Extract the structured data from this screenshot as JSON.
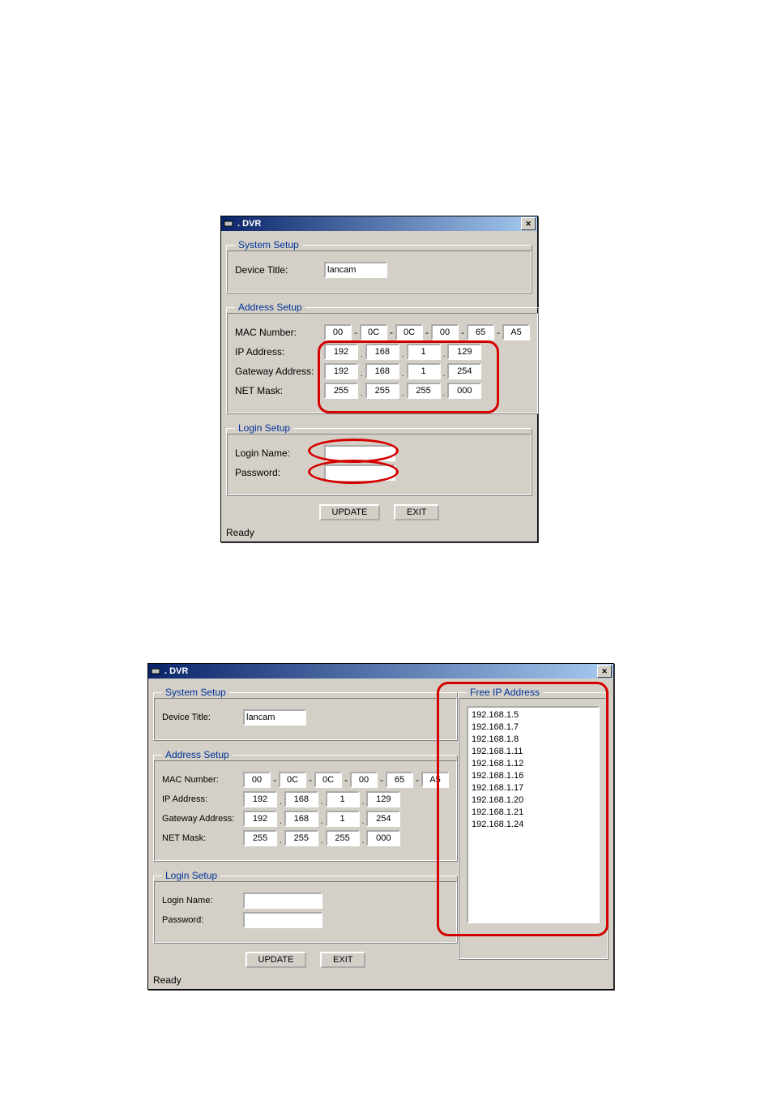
{
  "win1": {
    "title": ". DVR",
    "system_setup": {
      "legend": "System Setup",
      "device_title_label": "Device Title:",
      "device_title_value": "lancam"
    },
    "address_setup": {
      "legend": "Address Setup",
      "mac_label": "MAC Number:",
      "mac": [
        "00",
        "0C",
        "0C",
        "00",
        "65",
        "A5"
      ],
      "ip_label": "IP Address:",
      "ip": [
        "192",
        "168",
        "1",
        "129"
      ],
      "gw_label": "Gateway Address:",
      "gw": [
        "192",
        "168",
        "1",
        "254"
      ],
      "mask_label": "NET Mask:",
      "mask": [
        "255",
        "255",
        "255",
        "000"
      ]
    },
    "login_setup": {
      "legend": "Login Setup",
      "login_label": "Login Name:",
      "login_value": "",
      "password_label": "Password:",
      "password_value": ""
    },
    "buttons": {
      "update": "UPDATE",
      "exit": "EXIT"
    },
    "status": "Ready"
  },
  "win2": {
    "title": ". DVR",
    "system_setup": {
      "legend": "System Setup",
      "device_title_label": "Device Title:",
      "device_title_value": "lancam"
    },
    "address_setup": {
      "legend": "Address Setup",
      "mac_label": "MAC Number:",
      "mac": [
        "00",
        "0C",
        "0C",
        "00",
        "65",
        "A5"
      ],
      "ip_label": "IP Address:",
      "ip": [
        "192",
        "168",
        "1",
        "129"
      ],
      "gw_label": "Gateway Address:",
      "gw": [
        "192",
        "168",
        "1",
        "254"
      ],
      "mask_label": "NET Mask:",
      "mask": [
        "255",
        "255",
        "255",
        "000"
      ]
    },
    "login_setup": {
      "legend": "Login Setup",
      "login_label": "Login Name:",
      "login_value": "",
      "password_label": "Password:",
      "password_value": ""
    },
    "free_ip": {
      "legend": "Free IP Address",
      "items": [
        "192.168.1.5",
        "192.168.1.7",
        "192.168.1.8",
        "192.168.1.11",
        "192.168.1.12",
        "192.168.1.16",
        "192.168.1.17",
        "192.168.1.20",
        "192.168.1.21",
        "192.168.1.24"
      ]
    },
    "buttons": {
      "update": "UPDATE",
      "exit": "EXIT"
    },
    "status": "Ready"
  }
}
